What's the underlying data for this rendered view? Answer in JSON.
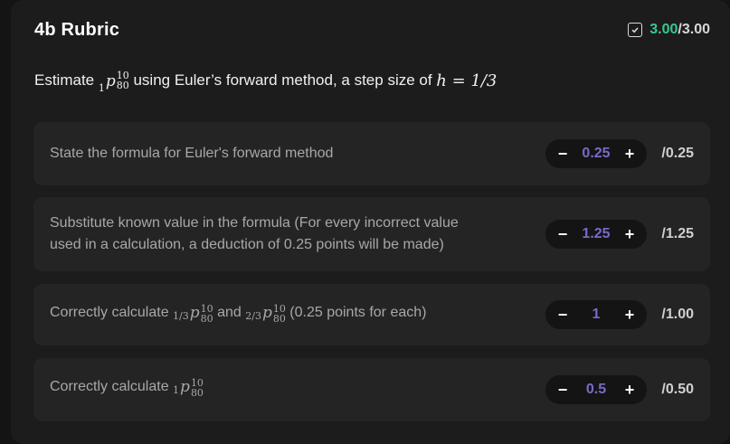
{
  "header": {
    "title": "4b Rubric",
    "score_earned": "3.00",
    "score_total": "/3.00",
    "check_icon": "checkbox-check-icon"
  },
  "prompt": {
    "prefix": "Estimate ",
    "symbol": {
      "pre": "1",
      "base": "p",
      "sup": "10",
      "sub": "80"
    },
    "middle": " using Euler’s forward method, a step size of ",
    "h_expr": "h = 1/3"
  },
  "criteria": [
    {
      "label": "State the formula for Euler's forward method",
      "value": "0.25",
      "max": "/0.25"
    },
    {
      "label_line1": "Substitute known value in the formula (For every incorrect value",
      "label_line2": "used in a calculation, a deduction of 0.25 points will be made)",
      "value": "1.25",
      "max": "/1.25"
    },
    {
      "label_prefix": "Correctly calculate ",
      "sym1": {
        "pre": "1/3",
        "base": "p",
        "sup": "10",
        "sub": "80"
      },
      "label_and": " and ",
      "sym2": {
        "pre": "2/3",
        "base": "p",
        "sup": "10",
        "sub": "80"
      },
      "label_suffix": " (0.25 points for each)",
      "value": "1",
      "max": "/1.00"
    },
    {
      "label_prefix": "Correctly calculate ",
      "sym": {
        "pre": "1",
        "base": "p",
        "sup": "10",
        "sub": "80"
      },
      "value": "0.5",
      "max": "/0.50"
    }
  ],
  "stepper": {
    "minus": "−",
    "plus": "+"
  },
  "colors": {
    "earned": "#37c98e",
    "value": "#7b69c9",
    "card": "#242424",
    "panel": "#1c1c1c"
  }
}
